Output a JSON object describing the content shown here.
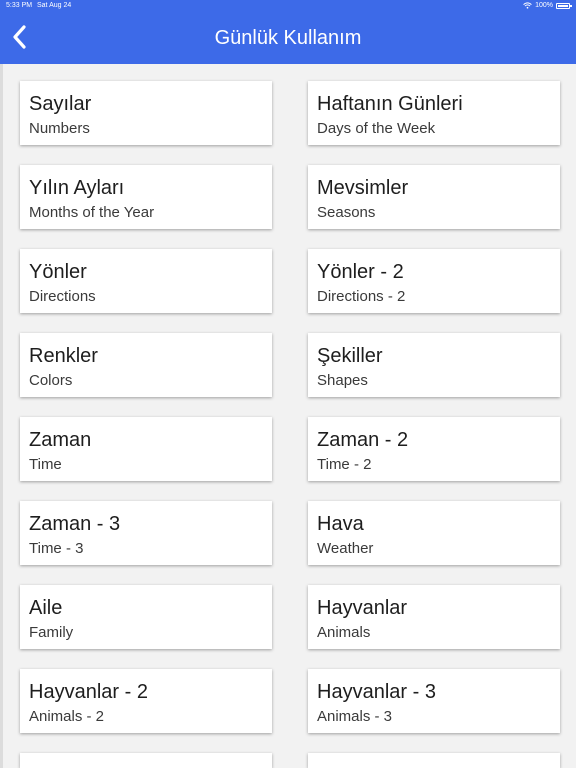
{
  "status_bar": {
    "time": "5:33 PM",
    "date": "Sat Aug 24",
    "battery": "100%"
  },
  "header": {
    "title": "Günlük Kullanım",
    "back_icon": "chevron-left-icon"
  },
  "colors": {
    "accent": "#3d6ae8",
    "background": "#f2f2f2",
    "card": "#ffffff"
  },
  "categories": [
    {
      "title": "Sayılar",
      "subtitle": "Numbers"
    },
    {
      "title": "Haftanın Günleri",
      "subtitle": "Days of the Week"
    },
    {
      "title": "Yılın Ayları",
      "subtitle": "Months of the Year"
    },
    {
      "title": "Mevsimler",
      "subtitle": "Seasons"
    },
    {
      "title": "Yönler",
      "subtitle": "Directions"
    },
    {
      "title": "Yönler - 2",
      "subtitle": "Directions - 2"
    },
    {
      "title": "Renkler",
      "subtitle": "Colors"
    },
    {
      "title": "Şekiller",
      "subtitle": "Shapes"
    },
    {
      "title": "Zaman",
      "subtitle": "Time"
    },
    {
      "title": "Zaman - 2",
      "subtitle": "Time - 2"
    },
    {
      "title": "Zaman - 3",
      "subtitle": "Time - 3"
    },
    {
      "title": "Hava",
      "subtitle": "Weather"
    },
    {
      "title": "Aile",
      "subtitle": "Family"
    },
    {
      "title": "Hayvanlar",
      "subtitle": "Animals"
    },
    {
      "title": "Hayvanlar - 2",
      "subtitle": "Animals - 2"
    },
    {
      "title": "Hayvanlar - 3",
      "subtitle": "Animals - 3"
    }
  ]
}
